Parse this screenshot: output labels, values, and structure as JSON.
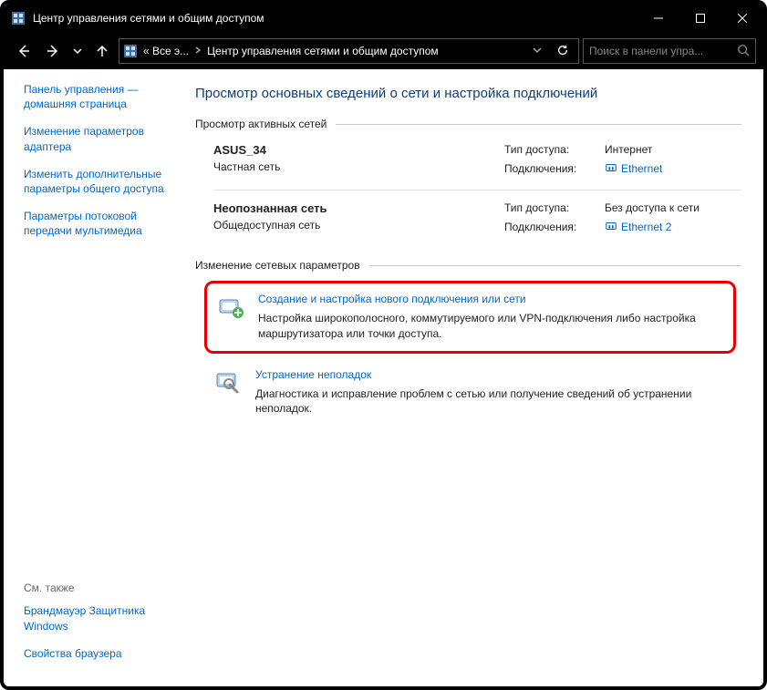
{
  "window": {
    "title": "Центр управления сетями и общим доступом"
  },
  "nav": {
    "crumb_prefix": "« Все э...",
    "crumb_current": "Центр управления сетями и общим доступом",
    "search_placeholder": "Поиск в панели упра..."
  },
  "sidebar": {
    "home": "Панель управления — домашняя страница",
    "links": [
      "Изменение параметров адаптера",
      "Изменить дополнительные параметры общего доступа",
      "Параметры потоковой передачи мультимедиа"
    ],
    "see_also_label": "См. также",
    "see_also": [
      "Брандмауэр Защитника Windows",
      "Свойства браузера"
    ]
  },
  "main": {
    "heading": "Просмотр основных сведений о сети и настройка подключений",
    "active_label": "Просмотр активных сетей",
    "labels": {
      "access_type": "Тип доступа:",
      "connections": "Подключения:"
    },
    "networks": [
      {
        "name": "ASUS_34",
        "category": "Частная сеть",
        "access": "Интернет",
        "connection": "Ethernet"
      },
      {
        "name": "Неопознанная сеть",
        "category": "Общедоступная сеть",
        "access": "Без доступа к сети",
        "connection": "Ethernet 2"
      }
    ],
    "change_label": "Изменение сетевых параметров",
    "tasks": [
      {
        "title": "Создание и настройка нового подключения или сети",
        "desc": "Настройка широкополосного, коммутируемого или VPN-подключения либо настройка маршрутизатора или точки доступа."
      },
      {
        "title": "Устранение неполадок",
        "desc": "Диагностика и исправление проблем с сетью или получение сведений об устранении неполадок."
      }
    ]
  }
}
